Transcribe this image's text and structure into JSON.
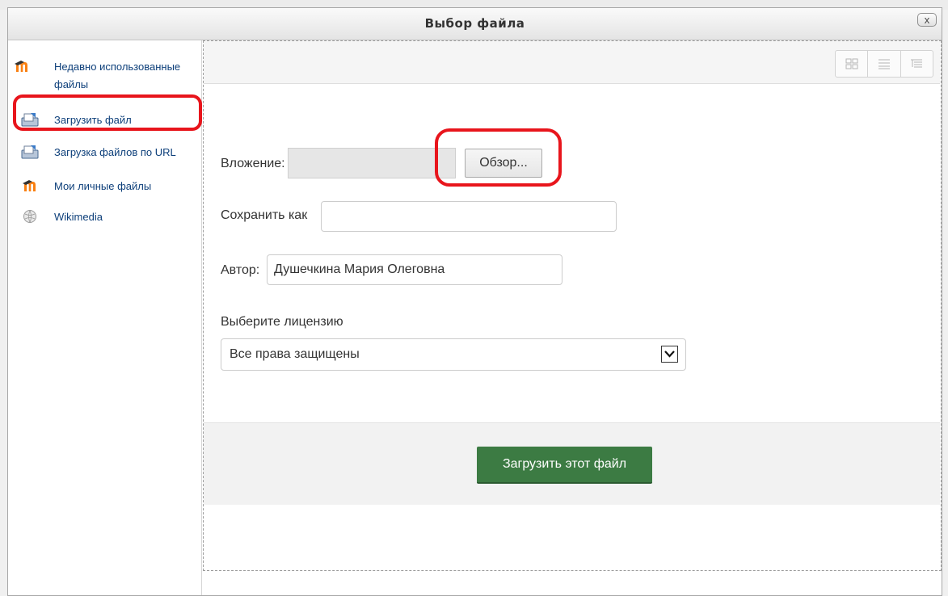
{
  "dialog": {
    "title": "Выбор файла",
    "close_label": "x"
  },
  "sidebar": {
    "items": [
      {
        "label": "Недавно использованные файлы",
        "icon": "moodle-icon"
      },
      {
        "label": "Загрузить файл",
        "icon": "upload-icon"
      },
      {
        "label": "Загрузка файлов по URL",
        "icon": "upload-url-icon"
      },
      {
        "label": "Мои личные файлы",
        "icon": "moodle-icon"
      },
      {
        "label": "Wikimedia",
        "icon": "wikimedia-icon"
      }
    ]
  },
  "toolbar": {
    "views": [
      "icons-view",
      "list-view",
      "tree-view"
    ]
  },
  "form": {
    "attachment_label": "Вложение:",
    "browse_label": "Обзор...",
    "save_as_label": "Сохранить как",
    "save_as_value": "",
    "author_label": "Автор:",
    "author_value": "Душечкина Мария Олеговна",
    "license_label": "Выберите лицензию",
    "license_value": "Все права защищены",
    "upload_label": "Загрузить этот файл"
  },
  "colors": {
    "accent_green": "#3c7b43",
    "highlight_red": "#e8151c",
    "link_blue": "#0d3f7a"
  }
}
